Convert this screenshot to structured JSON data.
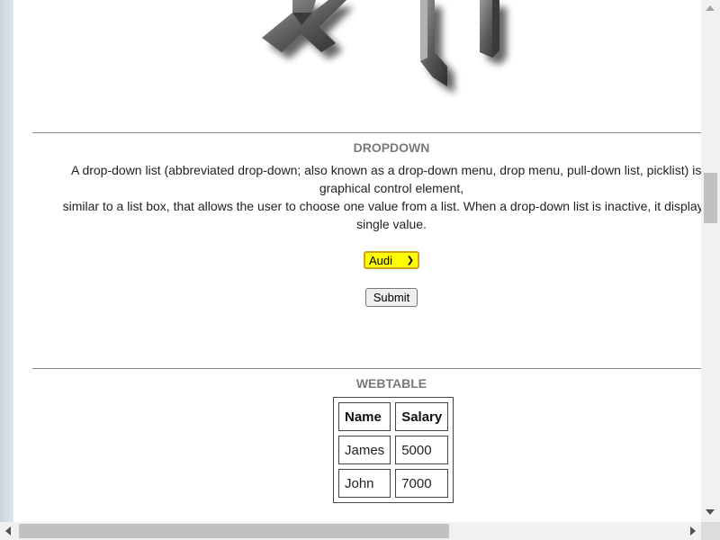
{
  "logo": {
    "icon": "3d-logo-icon"
  },
  "dropdown_section": {
    "title": "DROPDOWN",
    "description_lines": [
      "A drop-down list (abbreviated drop-down; also known as a drop-down menu, drop menu, pull-down list, picklist) is a",
      "graphical control element,",
      "similar to a list box, that allows the user to choose one value from a list. When a drop-down list is inactive, it displays a",
      "single value."
    ],
    "select": {
      "selected": "Audi",
      "background": "#ffff00",
      "border": "#d4a21a"
    },
    "submit_label": "Submit"
  },
  "webtable_section": {
    "title": "WEBTABLE",
    "headers": [
      "Name",
      "Salary"
    ],
    "rows": [
      [
        "James",
        "5000"
      ],
      [
        "John",
        "7000"
      ]
    ]
  }
}
